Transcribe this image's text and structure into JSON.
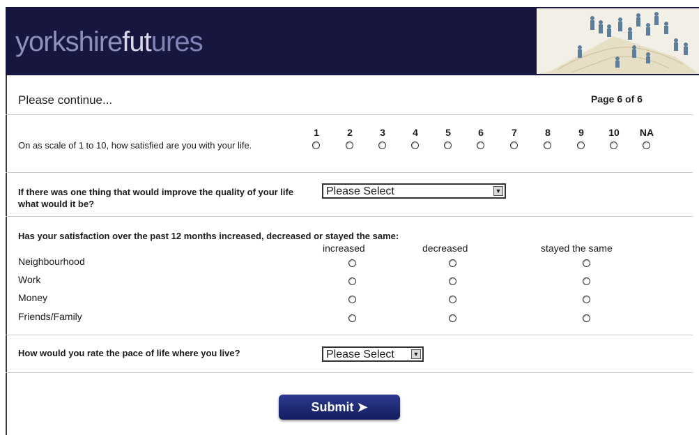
{
  "header": {
    "brand_part1": "yorkshire",
    "brand_part2": "fut",
    "brand_part3": "ures"
  },
  "intro": {
    "continue_text": "Please continue...",
    "page_indicator": "Page 6 of 6"
  },
  "q1": {
    "text": "On as scale of 1 to 10, how satisfied are you with your life.",
    "scale": [
      "1",
      "2",
      "3",
      "4",
      "5",
      "6",
      "7",
      "8",
      "9",
      "10",
      "NA"
    ]
  },
  "q2": {
    "text": "If there was one thing that would improve the quality of your life what would it be?",
    "select_value": "Please Select"
  },
  "q3": {
    "text": "Has your satisfaction over the past 12 months increased, decreased or stayed the same:",
    "columns": [
      "increased",
      "decreased",
      "stayed the same"
    ],
    "rows": [
      "Neighbourhood",
      "Work",
      "Money",
      "Friends/Family"
    ]
  },
  "q4": {
    "text": "How would you rate the pace of life where you live?",
    "select_value": "Please Select"
  },
  "submit": {
    "label": "Submit",
    "icon": "arrow-right-icon"
  },
  "colors": {
    "header_bg": "#17163f",
    "submit_bg": "#1f2a7a"
  }
}
